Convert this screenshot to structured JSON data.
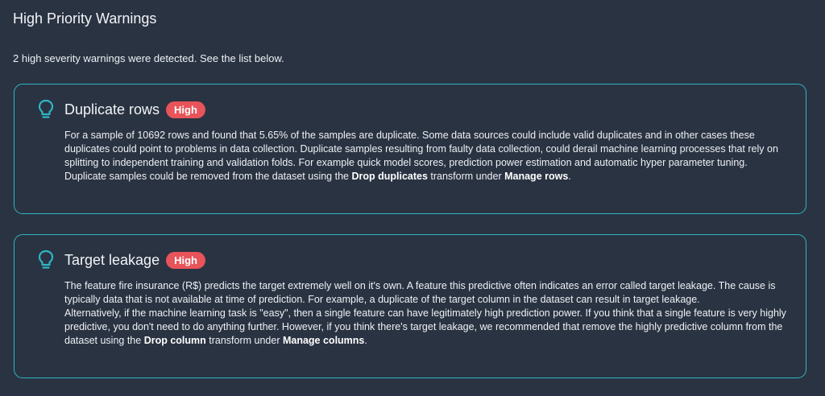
{
  "page_title": "High Priority Warnings",
  "summary": "2 high severity warnings were detected. See the list below.",
  "accent_color": "#2fb5c4",
  "badge_color": "#e8545a",
  "warnings": [
    {
      "icon": "lightbulb-icon",
      "title": "Duplicate rows",
      "severity": "High",
      "text_main": "For a sample of 10692 rows and found that 5.65% of the samples are duplicate. Some data sources could include valid duplicates and in other cases these duplicates could point to problems in data collection. Duplicate samples resulting from faulty data collection, could derail machine learning processes that rely on splitting to independent training and validation folds. For example quick model scores, prediction power estimation and automatic hyper parameter tuning. Duplicate samples could be removed from the dataset using the ",
      "bold_transform": "Drop duplicates",
      "text_mid": " transform under ",
      "bold_manage": "Manage rows",
      "text_end": "."
    },
    {
      "icon": "lightbulb-icon",
      "title": "Target leakage",
      "severity": "High",
      "text_para1": "The feature fire insurance (R$) predicts the target extremely well on it's own. A feature this predictive often indicates an error called target leakage. The cause is typically data that is not available at time of prediction. For example, a duplicate of the target column in the dataset can result in target leakage.",
      "text_main": "Alternatively, if the machine learning task is \"easy\", then a single feature can have legitimately high prediction power. If you think that a single feature is very highly predictive, you don't need to do anything further. However, if you think there's target leakage, we recommended that remove the highly predictive column from the dataset using the ",
      "bold_transform": "Drop column",
      "text_mid": " transform under ",
      "bold_manage": "Manage columns",
      "text_end": "."
    }
  ]
}
